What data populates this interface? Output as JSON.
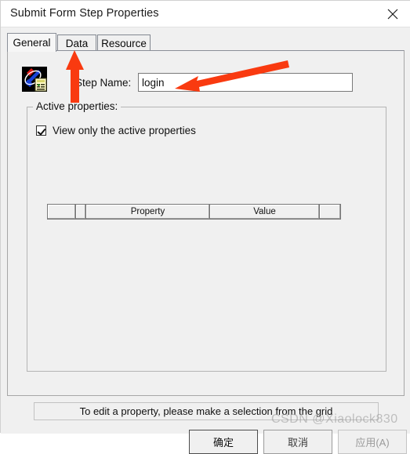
{
  "window": {
    "title": "Submit Form Step Properties",
    "close_icon": "close-icon"
  },
  "tabs": [
    {
      "label": "General",
      "selected": true
    },
    {
      "label": "Data",
      "selected": false
    },
    {
      "label": "Resource",
      "selected": false
    }
  ],
  "general": {
    "icon_name": "submit-form-step-icon",
    "step_name_label": "Step Name:",
    "step_name_value": "login",
    "step_name_placeholder": ""
  },
  "active_properties": {
    "group_title": "Active properties:",
    "checkbox_label": "View only the active properties",
    "checkbox_checked": true,
    "grid": {
      "columns": [
        "",
        "",
        "Property",
        "Value",
        ""
      ]
    },
    "hint": "To edit a property, please make a selection from the grid"
  },
  "buttons": {
    "ok": "确定",
    "cancel": "取消",
    "apply": "应用(A)"
  },
  "annotations": {
    "arrow_to_data_tab": "red-arrow-up-icon",
    "arrow_to_step_name": "red-arrow-left-icon"
  },
  "watermark": "CSDN @Xiaolock830",
  "colors": {
    "accent_red": "#f93a10",
    "dialog_bg": "#f0f0f0",
    "titlebar_bg": "#ffffff",
    "field_bg": "#ffffff"
  }
}
